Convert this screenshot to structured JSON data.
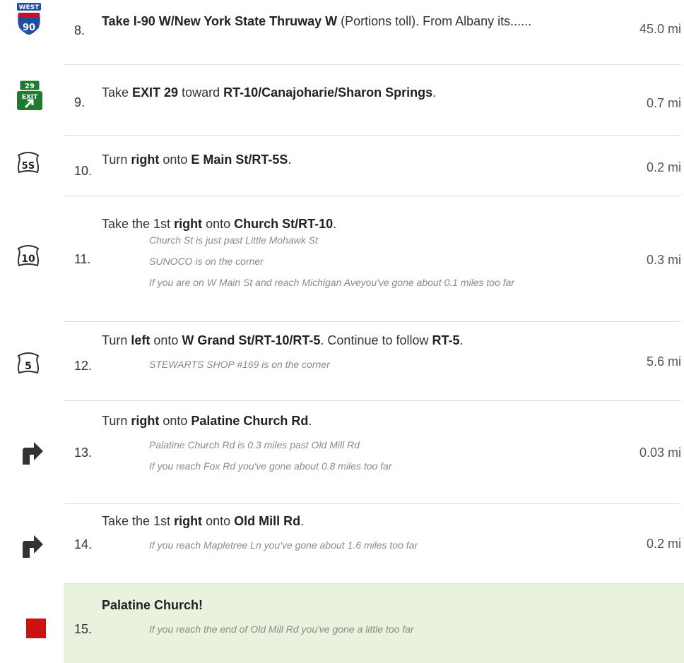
{
  "colors": {
    "destination_background": "#e9f2dd",
    "interstate_shield_blue": "#1d4f9f",
    "interstate_shield_red": "#c8102e",
    "exit_sign_green": "#1e7a2c",
    "destination_marker": "#cc1111",
    "separator": "#dddddd"
  },
  "steps": [
    {
      "number": "8.",
      "icon": "interstate-90-west-shield",
      "icon_text": {
        "direction": "WEST",
        "route": "90"
      },
      "instruction": {
        "pre": "",
        "b1": "Take I-90 W/New York State Thruway W",
        "mid": " (Portions toll).  From Albany its......"
      },
      "distance": "45.0 mi"
    },
    {
      "number": "9.",
      "icon": "exit-29-sign",
      "icon_text": {
        "exit_number": "29",
        "exit_label": "EXIT"
      },
      "instruction": {
        "pre": "Take ",
        "b1": "EXIT 29",
        "mid": " toward ",
        "b2": "RT-10/Canajoharie/Sharon Springs",
        "post": "."
      },
      "distance": "0.7 mi"
    },
    {
      "number": "10.",
      "icon": "route-5s-shield",
      "icon_text": {
        "route": "5S"
      },
      "instruction": {
        "pre": "Turn ",
        "b1": "right",
        "mid": " onto ",
        "b2": "E Main St/RT-5S",
        "post": "."
      },
      "distance": "0.2 mi"
    },
    {
      "number": "11.",
      "icon": "route-10-shield",
      "icon_text": {
        "route": "10"
      },
      "instruction": {
        "pre": "Take the 1st ",
        "b1": "right",
        "mid": " onto ",
        "b2": "Church St/RT-10",
        "post": "."
      },
      "notes": [
        "Church St is just past Little Mohawk St",
        "SUNOCO is on the corner",
        "If you are on W Main St and reach Michigan Aveyou've gone about 0.1 miles too far"
      ],
      "distance": "0.3 mi"
    },
    {
      "number": "12.",
      "icon": "route-5-shield",
      "icon_text": {
        "route": "5"
      },
      "instruction": {
        "pre": "Turn ",
        "b1": "left",
        "mid": " onto ",
        "b2": "W Grand St/RT-10/RT-5",
        "mid2": ". Continue to follow ",
        "b3": "RT-5",
        "post": "."
      },
      "notes": [
        "STEWARTS SHOP #169 is on the corner"
      ],
      "distance": "5.6 mi"
    },
    {
      "number": "13.",
      "icon": "turn-right-arrow",
      "instruction": {
        "pre": "Turn ",
        "b1": "right",
        "mid": " onto ",
        "b2": "Palatine Church Rd",
        "post": "."
      },
      "notes": [
        "Palatine Church Rd is 0.3 miles past Old Mill Rd",
        "If you reach Fox Rd you've gone about 0.8 miles too far"
      ],
      "distance": "0.03 mi"
    },
    {
      "number": "14.",
      "icon": "turn-right-arrow",
      "instruction": {
        "pre": "Take the 1st ",
        "b1": "right",
        "mid": " onto ",
        "b2": "Old Mill Rd",
        "post": "."
      },
      "notes": [
        "If you reach Mapletree Ln you've gone about 1.6 miles too far"
      ],
      "distance": "0.2 mi"
    },
    {
      "number": "15.",
      "icon": "destination-marker",
      "instruction": {
        "b1": "Palatine Church!"
      },
      "notes": [
        "If you reach the end of Old Mill Rd you've gone a little too far"
      ],
      "distance": ""
    }
  ]
}
